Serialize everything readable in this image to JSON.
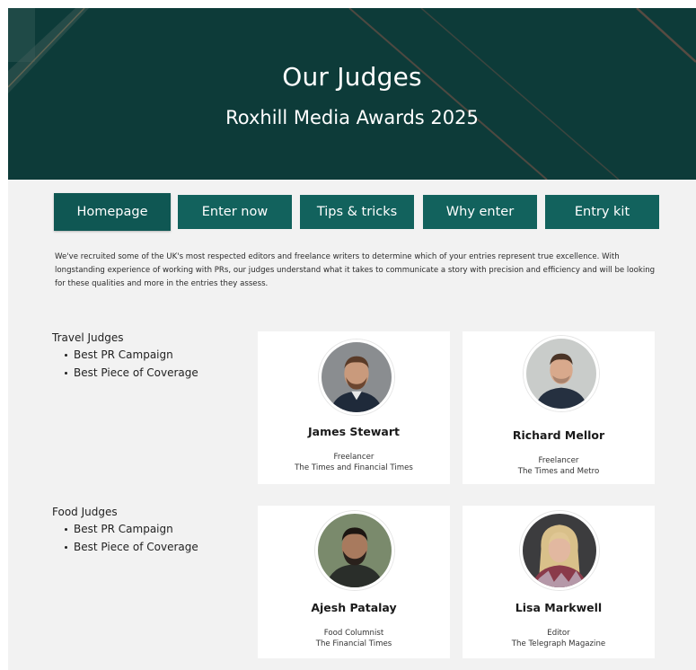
{
  "header": {
    "title": "Our Judges",
    "subtitle": "Roxhill Media Awards 2025"
  },
  "nav": {
    "items": [
      {
        "label": "Homepage",
        "active": true
      },
      {
        "label": "Enter now",
        "active": false
      },
      {
        "label": "Tips & tricks",
        "active": false
      },
      {
        "label": "Why enter",
        "active": false
      },
      {
        "label": "Entry kit",
        "active": false
      }
    ]
  },
  "intro": {
    "text": "We've recruited some of the UK's most respected editors and freelance writers to determine which of your entries represent true excellence. With longstanding experience of working with PRs, our judges understand what it takes to communicate a story with precision and efficiency and will be looking for these qualities and more in the entries they assess."
  },
  "categories": [
    {
      "title": "Travel Judges",
      "awards": [
        "Best PR Campaign",
        "Best Piece of Coverage"
      ],
      "judges": [
        {
          "name": "James Stewart",
          "role": "Freelancer",
          "outlet": "The Times and Financial Times"
        },
        {
          "name": "Richard Mellor",
          "role": "Freelancer",
          "outlet": "The Times and Metro"
        }
      ]
    },
    {
      "title": "Food Judges",
      "awards": [
        "Best PR Campaign",
        "Best Piece of Coverage"
      ],
      "judges": [
        {
          "name": "Ajesh Patalay",
          "role": "Food Columnist",
          "outlet": "The Financial Times"
        },
        {
          "name": "Lisa Markwell",
          "role": "Editor",
          "outlet": "The Telegraph Magazine"
        }
      ]
    }
  ],
  "colors": {
    "hero_bg": "#0d3b39",
    "button_bg": "#12625d",
    "page_bg": "#f2f2f2"
  }
}
